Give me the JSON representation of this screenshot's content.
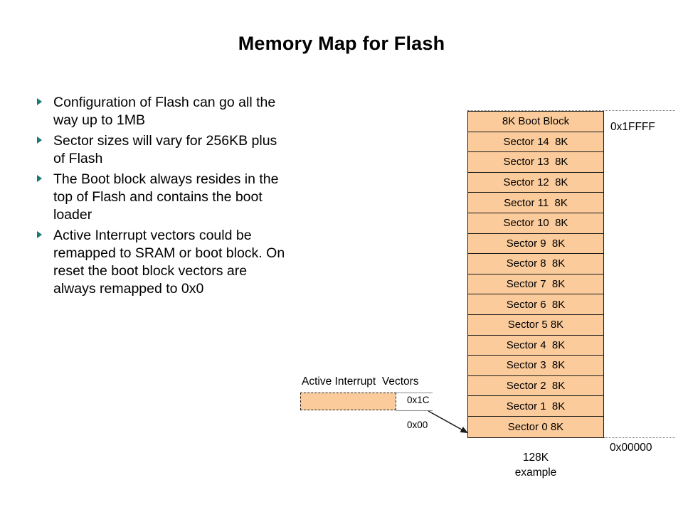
{
  "slide": {
    "title": "Memory Map for Flash",
    "bullets": [
      "Configuration of Flash can go all the\nway up to 1MB",
      "Sector sizes will vary for 256KB plus\nof Flash",
      "The Boot block always resides in the\ntop of Flash and contains the boot\nloader",
      "Active Interrupt vectors could be\nremapped to SRAM or boot block. On\nreset the boot block vectors are\nalways remapped to 0x0"
    ]
  },
  "flash_map": {
    "blocks": [
      "8K Boot Block",
      "Sector 14  8K",
      "Sector 13  8K",
      "Sector 12  8K",
      "Sector 11  8K",
      "Sector 10  8K",
      "Sector 9  8K",
      "Sector 8  8K",
      "Sector 7  8K",
      "Sector 6  8K",
      "Sector 5 8K",
      "Sector 4  8K",
      "Sector 3  8K",
      "Sector 2  8K",
      "Sector 1  8K",
      "Sector 0 8K"
    ],
    "top_address": "0x1FFFF",
    "bottom_address": "0x00000",
    "caption": "128K\nexample",
    "fill_color": "#FBCB9B",
    "border_color": "#1A1A1A"
  },
  "interrupt_vectors": {
    "title": "Active Interrupt  Vectors",
    "top_address": "0x1C",
    "bottom_address": "0x00",
    "fill_color": "#FBCB9B"
  },
  "theme": {
    "bullet_marker_color": "#167B74",
    "background": "#FFFFFF",
    "text_color": "#000000"
  }
}
